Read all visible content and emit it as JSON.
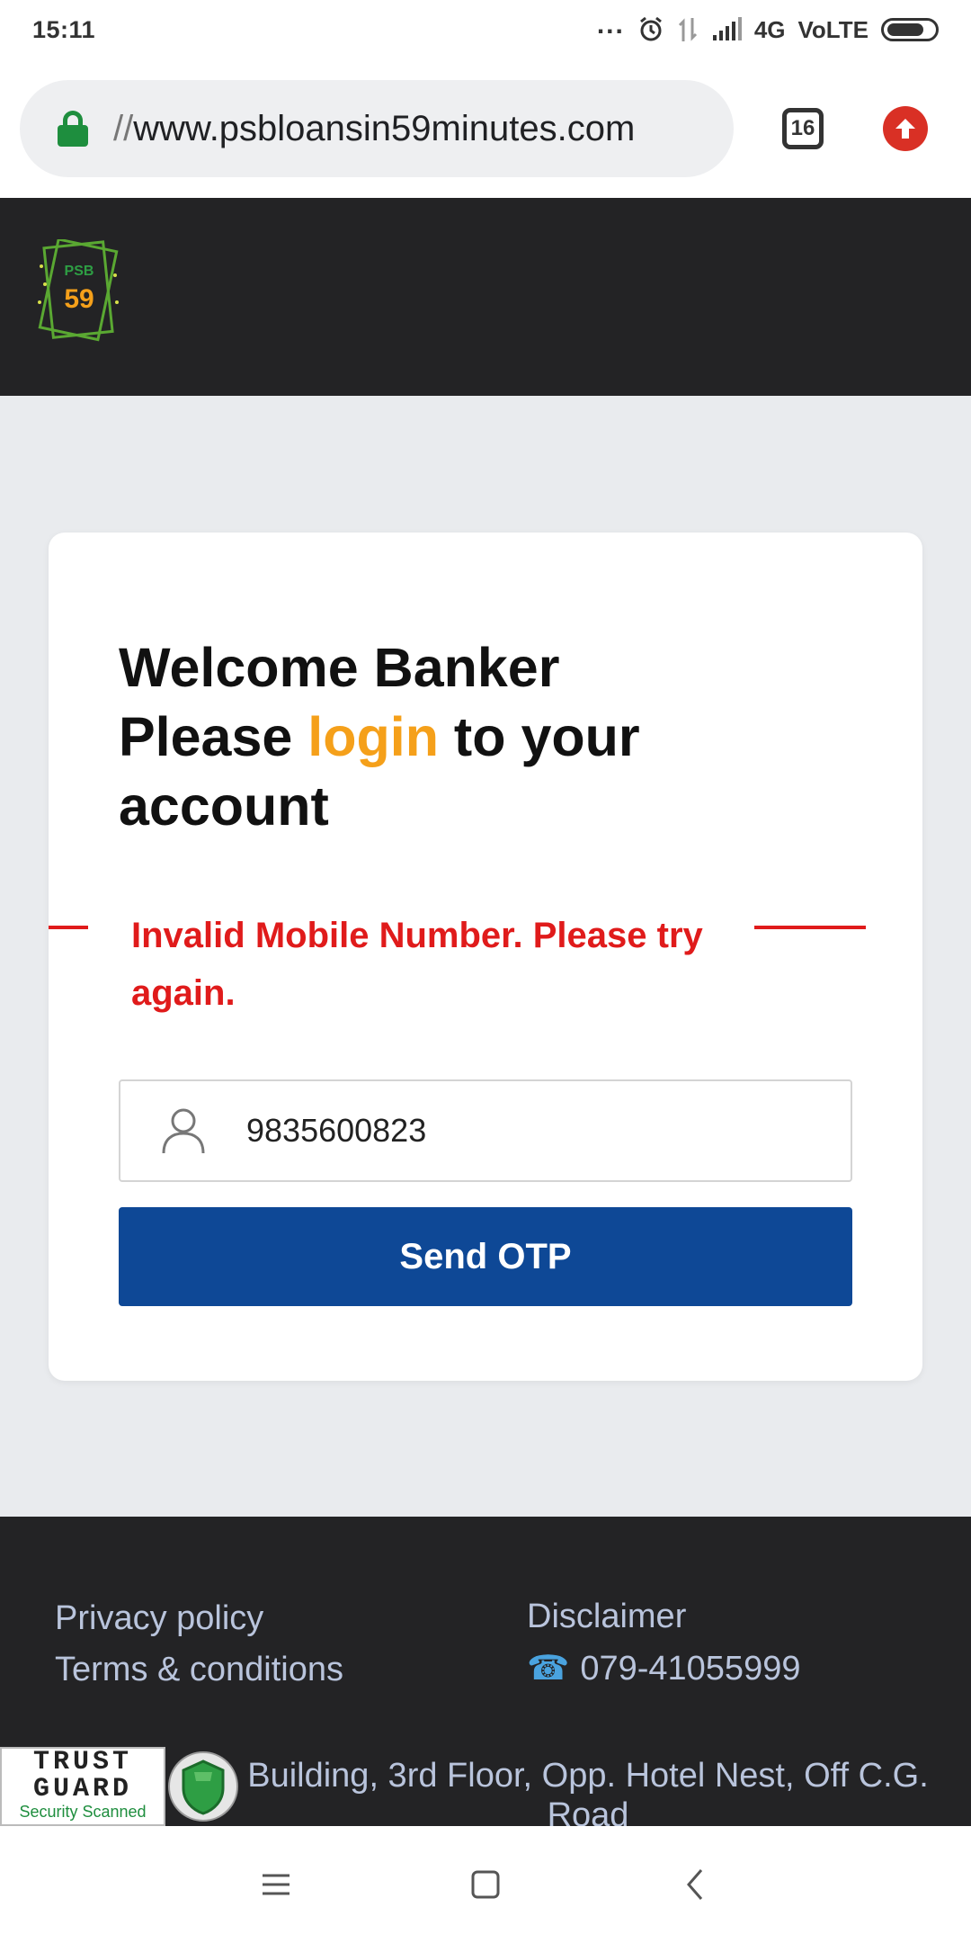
{
  "status_bar": {
    "time": "15:11",
    "dots": "...",
    "network": "4G",
    "volte": "VoLTE"
  },
  "browser": {
    "url_scheme": "//",
    "url_host": "www.psbloansin59minutes.com",
    "tab_count": "16"
  },
  "header": {
    "logo_text": "PSB 59"
  },
  "login": {
    "line1": "Welcome Banker",
    "line2_prefix": "Please ",
    "line2_highlight": "login",
    "line2_suffix": " to your",
    "line3": "account",
    "error": "Invalid Mobile Number. Please try again.",
    "mobile_value": "9835600823",
    "send_label": "Send OTP"
  },
  "footer": {
    "privacy": "Privacy policy",
    "terms": "Terms & conditions",
    "disclaimer": "Disclaimer",
    "phone": "079-41055999",
    "address": "Building, 3rd Floor, Opp. Hotel Nest, Off C.G. Road",
    "trust_line1": "TRUST",
    "trust_line2": "GUARD",
    "trust_line3": "Security Scanned"
  },
  "colors": {
    "highlight": "#f5a01a",
    "error": "#e01b1b",
    "button": "#0e4896",
    "header_bg": "#232325"
  }
}
